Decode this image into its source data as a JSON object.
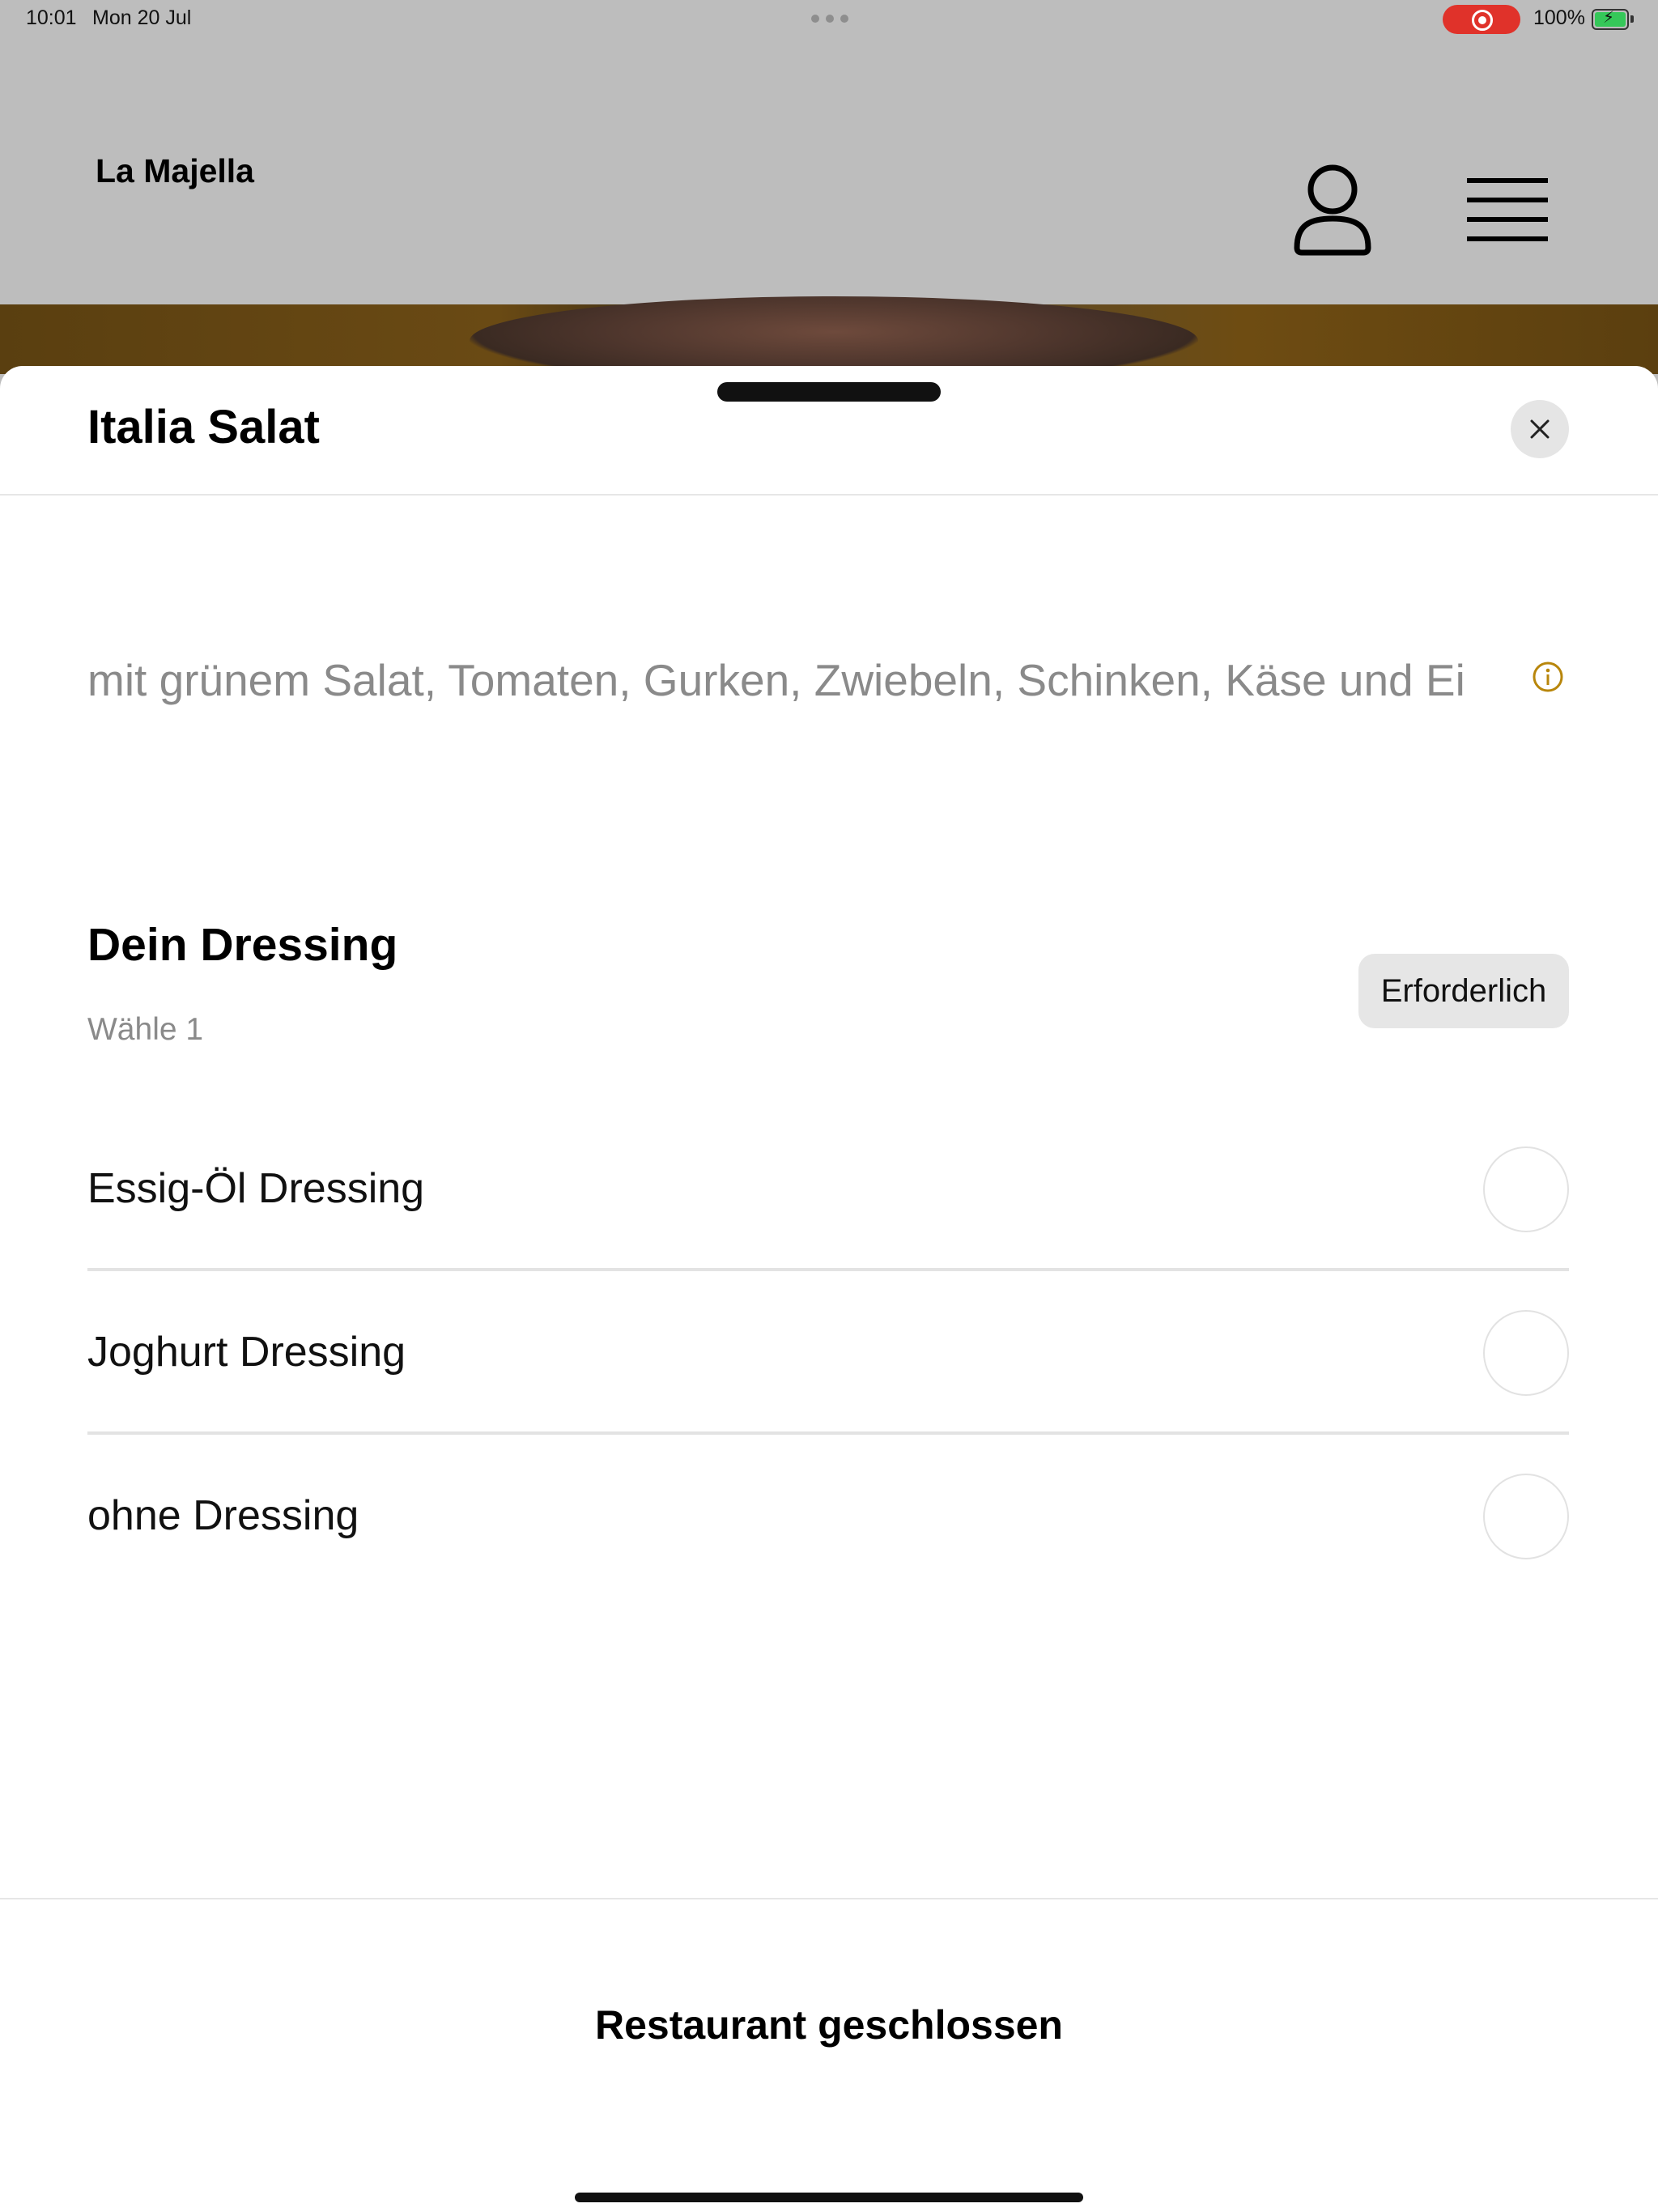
{
  "status_bar": {
    "time": "10:01",
    "date": "Mon 20 Jul",
    "battery": "100%",
    "recording_color": "#e0322a",
    "battery_color": "#35c759"
  },
  "header": {
    "brand": "La Majella",
    "icons": [
      "user-icon",
      "menu-icon"
    ]
  },
  "sheet": {
    "title": "Italia Salat",
    "description": "mit grünem Salat, Tomaten, Gurken, Zwiebeln, Schinken, Käse und Ei",
    "info_icon_color": "#b8860b",
    "section": {
      "title": "Dein Dressing",
      "subtitle": "Wähle 1",
      "badge": "Erforderlich",
      "options": [
        {
          "label": "Essig-Öl Dressing",
          "selected": false
        },
        {
          "label": "Joghurt Dressing",
          "selected": false
        },
        {
          "label": "ohne Dressing",
          "selected": false
        }
      ]
    },
    "footer": "Restaurant geschlossen"
  }
}
